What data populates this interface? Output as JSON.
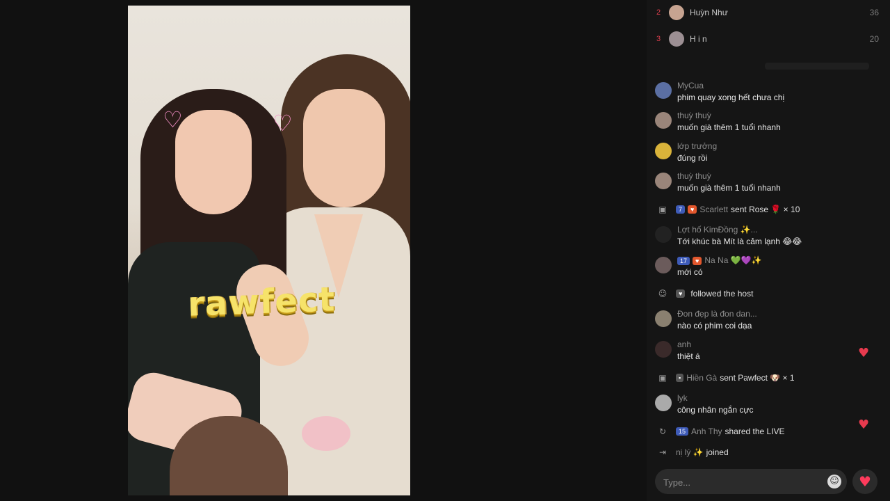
{
  "video": {
    "sticker_text": "rawfect"
  },
  "ranking": [
    {
      "rank": "2",
      "name": "Huỳn Như",
      "score": "36"
    },
    {
      "rank": "3",
      "name": "H i n",
      "score": "20"
    }
  ],
  "chat": [
    {
      "type": "msg",
      "user": "MyCua",
      "text": "phim quay xong hết chưa chị",
      "avatar_color": "#5b6fa3"
    },
    {
      "type": "msg",
      "user": "thuỳ thuỳ",
      "text": "muốn già thêm 1 tuổi nhanh",
      "avatar_color": "#9a857a"
    },
    {
      "type": "msg",
      "user": "lớp trưởng",
      "text": "đúng rồi",
      "avatar_color": "#d9b33a"
    },
    {
      "type": "msg",
      "user": "thuỳ thuỳ",
      "text": "muốn già thêm 1 tuổi nhanh",
      "avatar_color": "#9a857a"
    },
    {
      "type": "gift",
      "badge": "7",
      "user": "Scarlett",
      "text": "sent Rose 🌹 × 10"
    },
    {
      "type": "msg",
      "user": "Lợt hố KimĐồng ✨...",
      "text": "Tới khúc bà Mít là cảm lạnh 😂😂",
      "avatar_color": "#222222"
    },
    {
      "type": "msg",
      "user": "Na Na 💚💜✨",
      "text": "mới có",
      "badge": "17",
      "avatar_color": "#6b5b5b"
    },
    {
      "type": "follow",
      "user": "",
      "text": "followed the host"
    },
    {
      "type": "msg",
      "user": "Đon đẹp là đon dan...",
      "text": "nào có phim coi dạa",
      "avatar_color": "#8a8070"
    },
    {
      "type": "msg",
      "user": "anh",
      "text": "thiệt á",
      "avatar_color": "#3a2a2a"
    },
    {
      "type": "gift",
      "badge": "",
      "user": "Hiền Gà",
      "text": "sent Pawfect 🐶 × 1"
    },
    {
      "type": "msg",
      "user": "lyk",
      "text": "công nhân ngắn cực",
      "avatar_color": "#aaaaaa"
    },
    {
      "type": "share",
      "badge": "15",
      "user": "Anh Thy",
      "text": "shared the LIVE"
    },
    {
      "type": "join",
      "user": "nị lý ✨",
      "text": "joined"
    }
  ],
  "input": {
    "placeholder": "Type..."
  },
  "icons": {
    "emoji": "emoji-icon",
    "like": "heart-icon",
    "gift": "gift-icon",
    "follow": "person-icon",
    "share": "share-icon",
    "join": "join-icon"
  },
  "colors": {
    "like": "#ff3b5c",
    "rank": "#d83e4d"
  }
}
